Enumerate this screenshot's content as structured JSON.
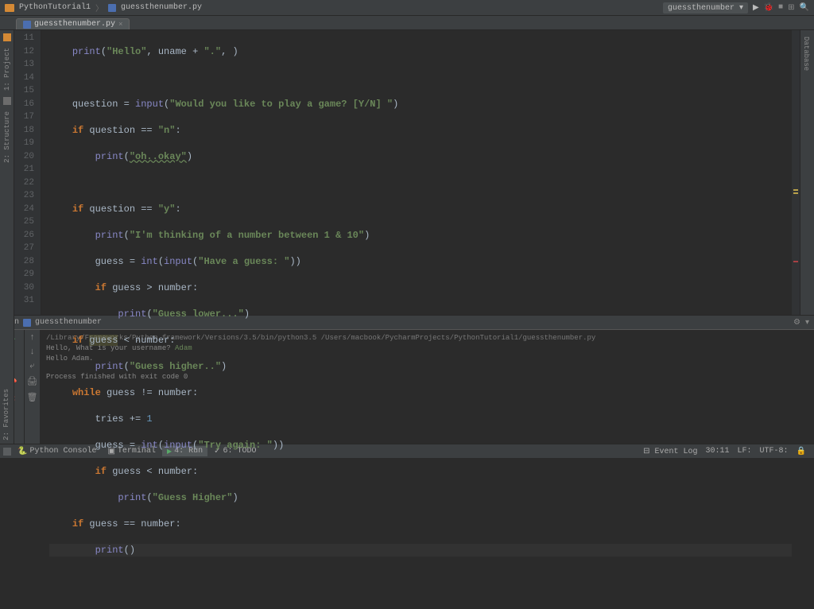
{
  "breadcrumb": {
    "project": "PythonTutorial1",
    "file": "guessthenumber.py"
  },
  "run_config": "guessthenumber",
  "tab": {
    "name": "guessthenumber.py"
  },
  "sidebar": {
    "project": "1: Project",
    "structure": "2: Structure",
    "favorites": "2: Favorites",
    "database": "Database"
  },
  "line_numbers": [
    "11",
    "12",
    "13",
    "14",
    "15",
    "16",
    "17",
    "18",
    "19",
    "20",
    "21",
    "22",
    "23",
    "24",
    "25",
    "26",
    "27",
    "28",
    "29",
    "30",
    "31"
  ],
  "code": {
    "l11": {
      "a": "print",
      "b": "(",
      "c": "\"Hello\"",
      "d": ", uname + ",
      "e": "\".\"",
      "f": ", )"
    },
    "l13": {
      "a": "question = ",
      "b": "input",
      "c": "(",
      "d": "\"Would you like to play a game? [Y/N] \"",
      "e": ")"
    },
    "l14": {
      "a": "if",
      "b": " question == ",
      "c": "\"n\"",
      "d": ":"
    },
    "l15": {
      "a": "print",
      "b": "(",
      "c": "\"oh..okay\"",
      "d": ")"
    },
    "l17": {
      "a": "if",
      "b": " question == ",
      "c": "\"y\"",
      "d": ":"
    },
    "l18": {
      "a": "print",
      "b": "(",
      "c": "\"I'm thinking of a number between 1 & 10\"",
      "d": ")"
    },
    "l19": {
      "a": "guess = ",
      "b": "int",
      "c": "(",
      "d": "input",
      "e": "(",
      "f": "\"Have a guess: \"",
      "g": "))"
    },
    "l20": {
      "a": "if",
      "b": " guess > number:"
    },
    "l21": {
      "a": "print",
      "b": "(",
      "c": "\"Guess lower...\"",
      "d": ")"
    },
    "l22": {
      "a": "if",
      "b": " ",
      "c": "guess",
      "d": " < number:"
    },
    "l23": {
      "a": "print",
      "b": "(",
      "c": "\"Guess higher..\"",
      "d": ")"
    },
    "l24": {
      "a": "while",
      "b": " guess != number:"
    },
    "l25": {
      "a": "tries += ",
      "b": "1"
    },
    "l26": {
      "a": "guess = ",
      "b": "int",
      "c": "(",
      "d": "input",
      "e": "(",
      "f": "\"Try again: \"",
      "g": "))"
    },
    "l27": {
      "a": "if",
      "b": " guess < number:"
    },
    "l28": {
      "a": "print",
      "b": "(",
      "c": "\"Guess Higher\"",
      "d": ")"
    },
    "l29": {
      "a": "if",
      "b": " guess == number:"
    },
    "l30": {
      "a": "print",
      "b": "()"
    }
  },
  "run": {
    "title": "Run",
    "target": "guessthenumber",
    "path": "/Library/Frameworks/Python.framework/Versions/3.5/bin/python3.5 /Users/macbook/PycharmProjects/PythonTutorial1/guessthenumber.py",
    "out1": "Hello, What is your username? ",
    "in1": "Adam",
    "out2": "Hello  Adam.",
    "exit": "Process finished with exit code 0"
  },
  "bottom": {
    "python_console": "Python Console",
    "terminal": "Terminal",
    "run_tab": "4: Run",
    "todo": "6: TODO",
    "event_log": "Event Log",
    "pos": "30:11",
    "lf": "LF:",
    "enc": "UTF-8:"
  }
}
